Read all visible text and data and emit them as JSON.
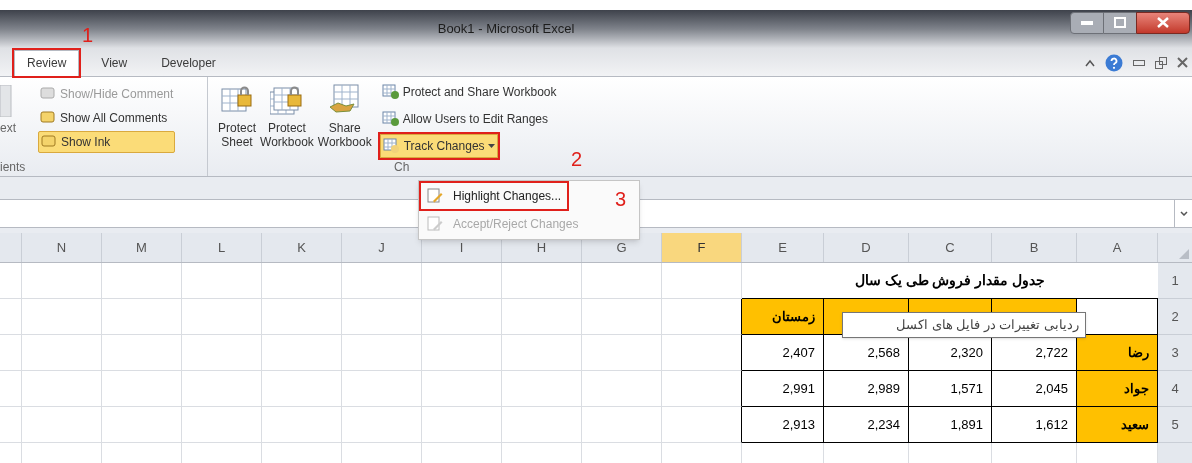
{
  "window": {
    "title": "Book1  -  Microsoft Excel"
  },
  "tabs": [
    {
      "label": "Review",
      "selected": true,
      "framed": true
    },
    {
      "label": "View",
      "selected": false,
      "framed": false
    },
    {
      "label": "Developer",
      "selected": false,
      "framed": false
    }
  ],
  "ribbon": {
    "cut_button": {
      "label": "ext"
    },
    "comment_items": [
      {
        "label": "Show/Hide Comment",
        "disabled": true,
        "selected": false
      },
      {
        "label": "Show All Comments",
        "disabled": false,
        "selected": false
      },
      {
        "label": "Show Ink",
        "disabled": false,
        "selected": true
      }
    ],
    "comments_group_label": "ients",
    "large_buttons": [
      {
        "kind": "sheet-lock",
        "lines": [
          "Protect",
          "Sheet"
        ]
      },
      {
        "kind": "book-lock",
        "lines": [
          "Protect",
          "Workbook"
        ]
      },
      {
        "kind": "share",
        "lines": [
          "Share",
          "Workbook"
        ]
      }
    ],
    "small_buttons": [
      {
        "label": "Protect and Share Workbook",
        "framed": false,
        "dropdown": false
      },
      {
        "label": "Allow Users to Edit Ranges",
        "framed": false,
        "dropdown": false
      },
      {
        "label": "Track Changes",
        "framed": true,
        "dropdown": true
      }
    ],
    "changes_group_label": "Ch"
  },
  "menu": {
    "items": [
      {
        "label": "Highlight Changes...",
        "disabled": false,
        "framed": true
      },
      {
        "label": "Accept/Reject Changes",
        "disabled": true,
        "framed": false
      }
    ]
  },
  "annotations": [
    {
      "label": "1"
    },
    {
      "label": "2"
    },
    {
      "label": "3"
    }
  ],
  "sheet": {
    "columns": [
      {
        "label": "N",
        "selected": false
      },
      {
        "label": "M",
        "selected": false
      },
      {
        "label": "L",
        "selected": false
      },
      {
        "label": "K",
        "selected": false
      },
      {
        "label": "J",
        "selected": false
      },
      {
        "label": "I",
        "selected": false
      },
      {
        "label": "H",
        "selected": false
      },
      {
        "label": "G",
        "selected": false
      },
      {
        "label": "F",
        "selected": true
      },
      {
        "label": "E",
        "selected": false
      },
      {
        "label": "D",
        "selected": false
      },
      {
        "label": "C",
        "selected": false
      },
      {
        "label": "B",
        "selected": false
      },
      {
        "label": "A",
        "selected": false
      }
    ],
    "title_row": {
      "number": "1",
      "text": "جدول مقدار فروش طی یک سال"
    },
    "rows": [
      {
        "number": "2",
        "cells": [
          {
            "kind": "header",
            "text": "زمستان"
          },
          {
            "kind": "header"
          },
          {
            "kind": "header"
          },
          {
            "kind": "header"
          },
          {
            "kind": "blank"
          }
        ]
      },
      {
        "number": "3",
        "cells": [
          {
            "kind": "number",
            "text": "2,407"
          },
          {
            "kind": "number",
            "text": "2,568"
          },
          {
            "kind": "number",
            "text": "2,320"
          },
          {
            "kind": "number",
            "text": "2,722"
          },
          {
            "kind": "name",
            "text": "رضا"
          }
        ]
      },
      {
        "number": "4",
        "cells": [
          {
            "kind": "number",
            "text": "2,991"
          },
          {
            "kind": "number",
            "text": "2,989"
          },
          {
            "kind": "number",
            "text": "1,571"
          },
          {
            "kind": "number",
            "text": "2,045"
          },
          {
            "kind": "name",
            "text": "جواد"
          }
        ]
      },
      {
        "number": "5",
        "cells": [
          {
            "kind": "number",
            "text": "2,913"
          },
          {
            "kind": "number",
            "text": "2,234"
          },
          {
            "kind": "number",
            "text": "1,891"
          },
          {
            "kind": "number",
            "text": "1,612"
          },
          {
            "kind": "name",
            "text": "سعید"
          }
        ]
      }
    ],
    "tooltip": "ردیابی تغییرات در فایل های اکسل"
  }
}
